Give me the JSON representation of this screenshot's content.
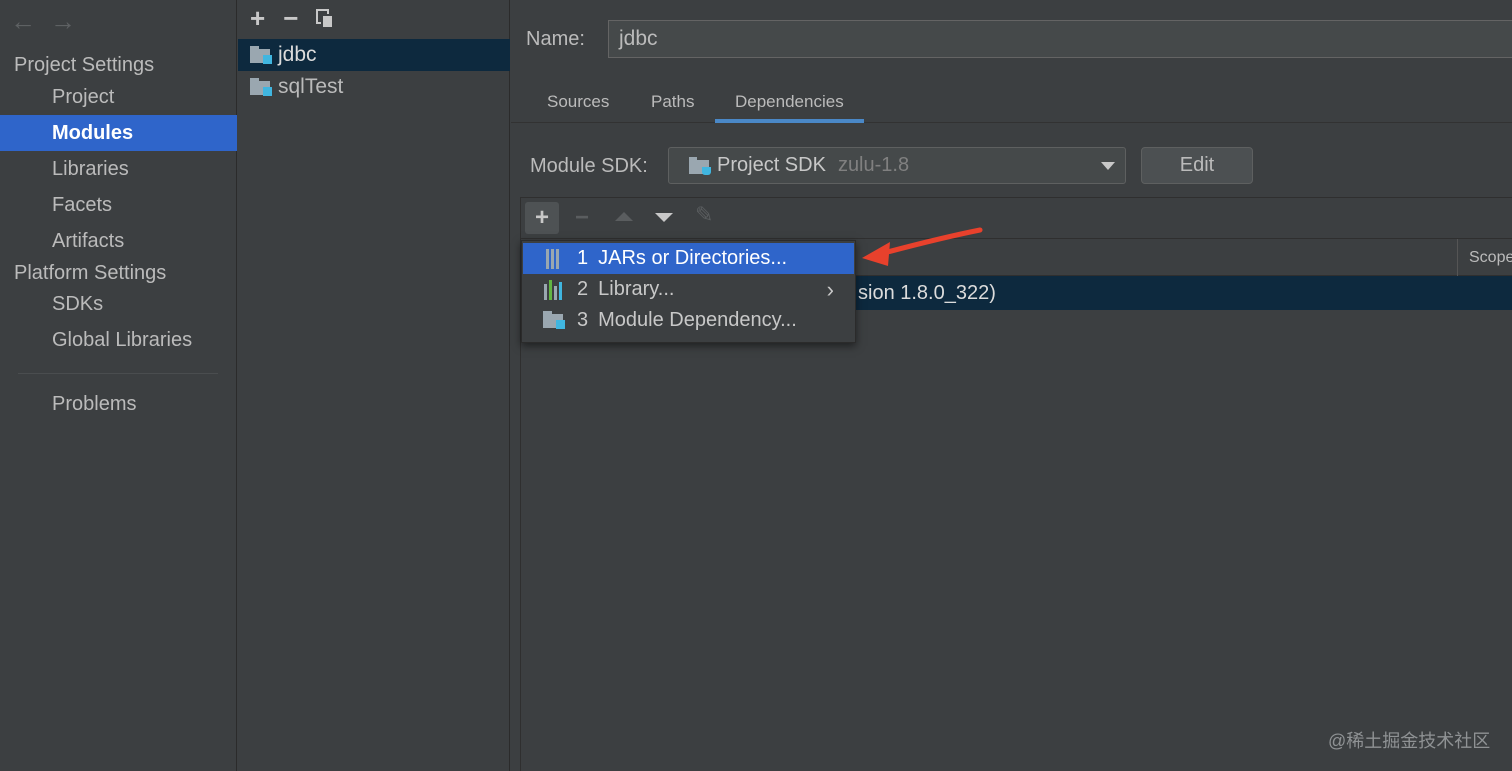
{
  "sidebar": {
    "back_icon": "←",
    "forward_icon": "→",
    "project_settings_header": "Project Settings",
    "project_items": [
      "Project",
      "Modules",
      "Libraries",
      "Facets",
      "Artifacts"
    ],
    "platform_settings_header": "Platform Settings",
    "platform_items": [
      "SDKs",
      "Global Libraries"
    ],
    "problems": "Problems",
    "selected": "Modules"
  },
  "module_list": {
    "toolbar": {
      "add": "+",
      "remove": "−"
    },
    "modules": [
      "jdbc",
      "sqlTest"
    ],
    "selected": "jdbc"
  },
  "main": {
    "name_label": "Name:",
    "name_value": "jdbc",
    "tabs": [
      "Sources",
      "Paths",
      "Dependencies"
    ],
    "active_tab": "Dependencies",
    "module_sdk_label": "Module SDK:",
    "sdk_value": "Project SDK",
    "sdk_detail": "zulu-1.8",
    "edit_button": "Edit",
    "dep_toolbar": {
      "add": "+",
      "remove": "−",
      "edit_icon": "✎"
    },
    "table": {
      "scope_header": "Scope",
      "sdk_row_visible_text": "sion 1.8.0_322)"
    }
  },
  "popup_menu": {
    "items": [
      {
        "number": "1",
        "label": "JARs or Directories...",
        "icon": "jar-directory-icon"
      },
      {
        "number": "2",
        "label": "Library...",
        "icon": "library-icon",
        "submenu": "›"
      },
      {
        "number": "3",
        "label": "Module Dependency...",
        "icon": "module-icon"
      }
    ],
    "highlighted_index": 0
  },
  "annotation": {
    "arrow_color": "#e8412c"
  },
  "watermark": "@稀土掘金技术社区",
  "colors": {
    "accent": "#2f65ca",
    "selection_dark": "#0d293e",
    "background": "#3c3f41",
    "sdk_badge": "#40b6e0"
  }
}
